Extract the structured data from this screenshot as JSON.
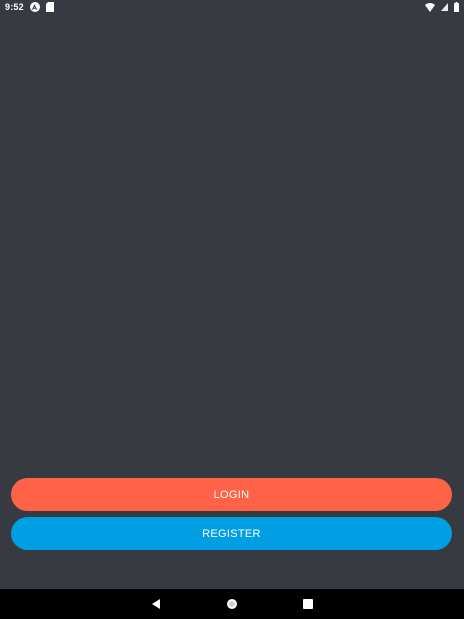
{
  "status_bar": {
    "time": "9:52",
    "left_icons": [
      "android-icon",
      "sd-card-icon"
    ],
    "right_icons": [
      "wifi-icon",
      "signal-icon",
      "battery-icon"
    ]
  },
  "actions": {
    "login_label": "LOGIN",
    "register_label": "REGISTER"
  },
  "nav_bar": {
    "buttons": [
      "back-icon",
      "home-icon",
      "recents-icon"
    ]
  },
  "colors": {
    "background": "#373a40",
    "login_button": "#ff6347",
    "register_button": "#009fe3",
    "nav_bar": "#000000"
  }
}
